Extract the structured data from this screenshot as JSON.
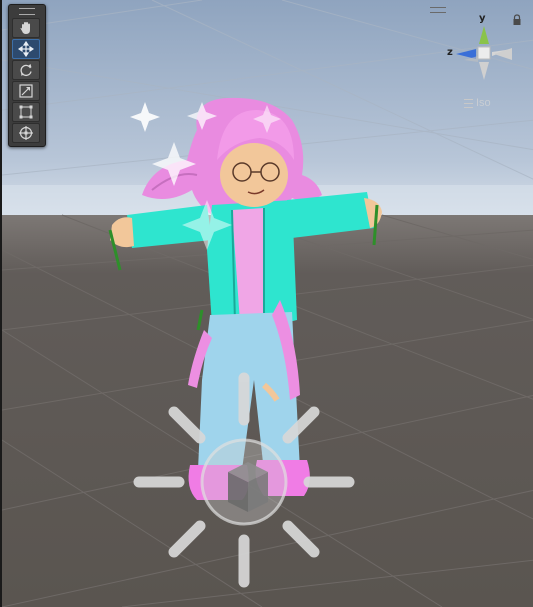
{
  "scene_view": {
    "tools": [
      {
        "name": "hand-tool",
        "icon": "hand-icon",
        "active": false
      },
      {
        "name": "move-tool",
        "icon": "move-icon",
        "active": true
      },
      {
        "name": "rotate-tool",
        "icon": "rotate-icon",
        "active": false
      },
      {
        "name": "scale-tool",
        "icon": "scale-icon",
        "active": false
      },
      {
        "name": "rect-tool",
        "icon": "rect-icon",
        "active": false
      },
      {
        "name": "transform-tool",
        "icon": "transform-icon",
        "active": false
      }
    ],
    "gizmo": {
      "y_label": "y",
      "z_label": "z",
      "projection_label": "Iso"
    },
    "colors": {
      "sky_top": "#8ea3bd",
      "sky_horizon": "#c9d4e2",
      "ground": "#5b5652",
      "axis_y": "#8ac34a",
      "axis_z": "#3a6fd8",
      "hair": "#ee8ce4",
      "jacket": "#2ee5cf",
      "pants": "#9fd4ec"
    }
  }
}
